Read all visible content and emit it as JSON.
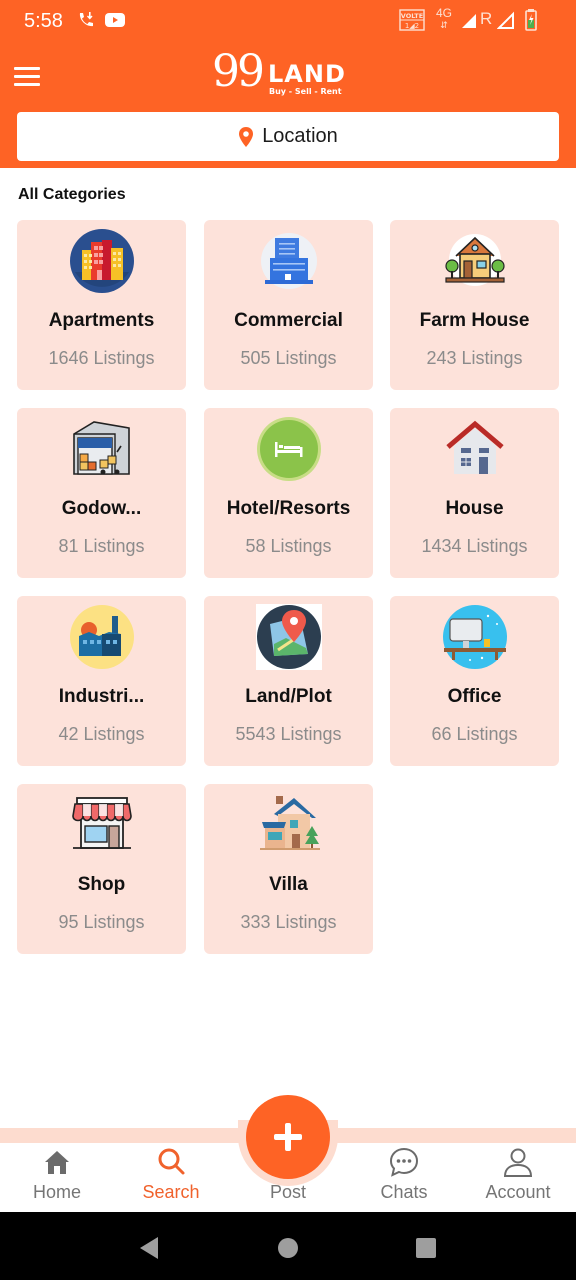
{
  "status_bar": {
    "time": "5:58",
    "icons": [
      "wifi-call-icon",
      "youtube-icon",
      "volte-icon",
      "4g-icon",
      "signal-icon",
      "roaming-icon",
      "signal-icon-2",
      "battery-charging-icon"
    ],
    "network_label": "4G",
    "roaming_label": "R",
    "volte_label": "VOLTE"
  },
  "header": {
    "logo_number": "99",
    "logo_word": "LAND",
    "logo_tagline": "Buy - Sell - Rent",
    "location_placeholder": "Location"
  },
  "colors": {
    "brand": "#fe6325",
    "card_bg": "#fde2da",
    "active_nav": "#f0622c"
  },
  "section_title": "All Categories",
  "categories": [
    {
      "name": "Apartments",
      "count": "1646 Listings",
      "icon": "apartments-icon"
    },
    {
      "name": "Commercial",
      "count": "505 Listings",
      "icon": "commercial-icon"
    },
    {
      "name": "Farm House",
      "count": "243 Listings",
      "icon": "farm-house-icon"
    },
    {
      "name": "Godow...",
      "count": "81 Listings",
      "icon": "godown-icon"
    },
    {
      "name": "Hotel/Resorts",
      "count": "58 Listings",
      "icon": "hotel-icon"
    },
    {
      "name": "House",
      "count": "1434 Listings",
      "icon": "house-icon"
    },
    {
      "name": "Industri...",
      "count": "42 Listings",
      "icon": "industrial-icon"
    },
    {
      "name": "Land/Plot",
      "count": "5543 Listings",
      "icon": "land-plot-icon"
    },
    {
      "name": "Office",
      "count": "66 Listings",
      "icon": "office-icon"
    },
    {
      "name": "Shop",
      "count": "95 Listings",
      "icon": "shop-icon"
    },
    {
      "name": "Villa",
      "count": "333 Listings",
      "icon": "villa-icon"
    }
  ],
  "bottom_nav": {
    "items": [
      {
        "label": "Home",
        "icon": "home-icon",
        "active": false
      },
      {
        "label": "Search",
        "icon": "search-icon",
        "active": true
      },
      {
        "label": "Post",
        "icon": "plus-icon",
        "active": false
      },
      {
        "label": "Chats",
        "icon": "chat-icon",
        "active": false
      },
      {
        "label": "Account",
        "icon": "account-icon",
        "active": false
      }
    ]
  }
}
